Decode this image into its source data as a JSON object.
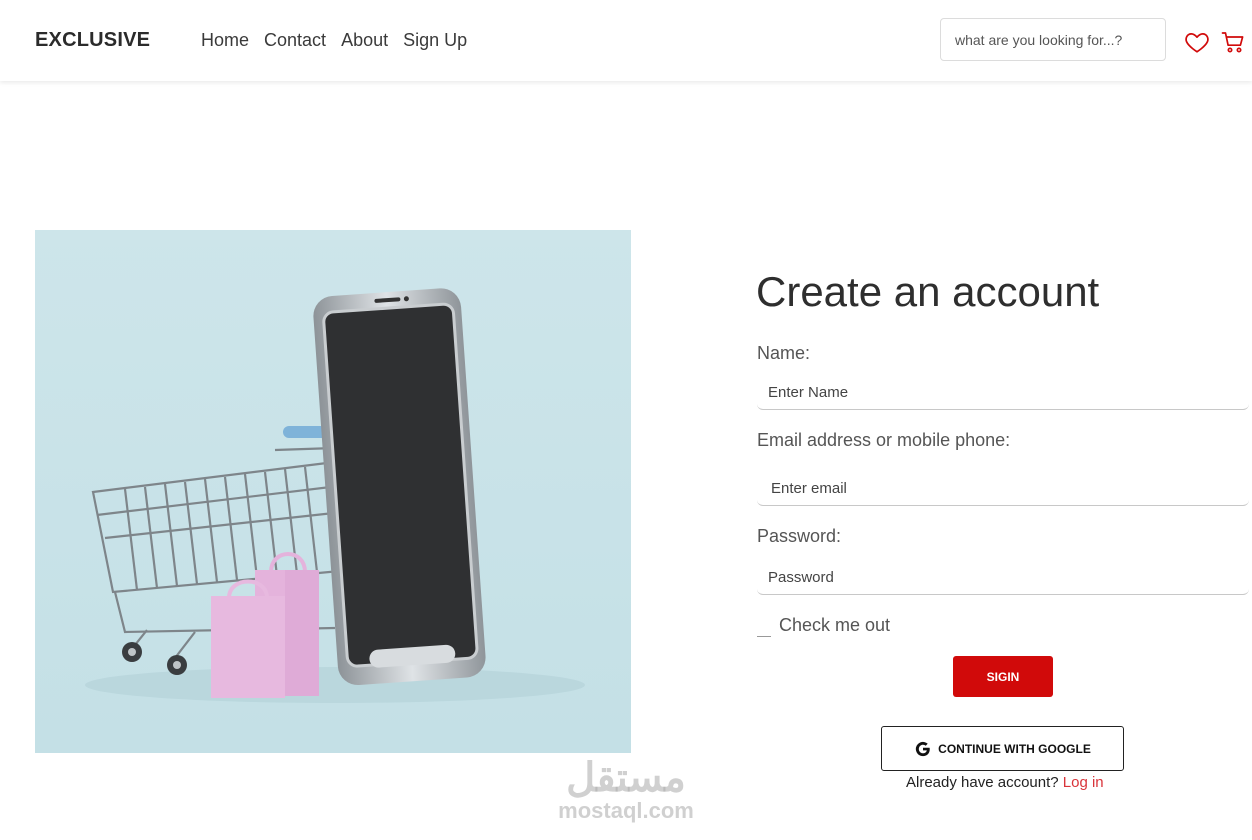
{
  "nav": {
    "brand": "EXCLUSIVE",
    "links": [
      "Home",
      "Contact",
      "About",
      "Sign Up"
    ],
    "search_placeholder": "what are you looking for...?",
    "icons": [
      "heart-icon",
      "cart-icon"
    ],
    "accent_color": "#d10a0a"
  },
  "form": {
    "title": "Create an account",
    "name_label": "Name:",
    "name_placeholder": "Enter Name",
    "email_label": "Email address or mobile phone:",
    "email_placeholder": "Enter email",
    "password_label": "Password:",
    "password_placeholder": "Password",
    "checkbox_label": "Check me out",
    "signin_label": "SIGIN",
    "google_label": "CONTINUE WITH GOOGLE",
    "already_text": "Already have account?",
    "login_link": "Log in"
  },
  "watermark": {
    "arabic": "مستقل",
    "latin": "mostaql.com"
  }
}
